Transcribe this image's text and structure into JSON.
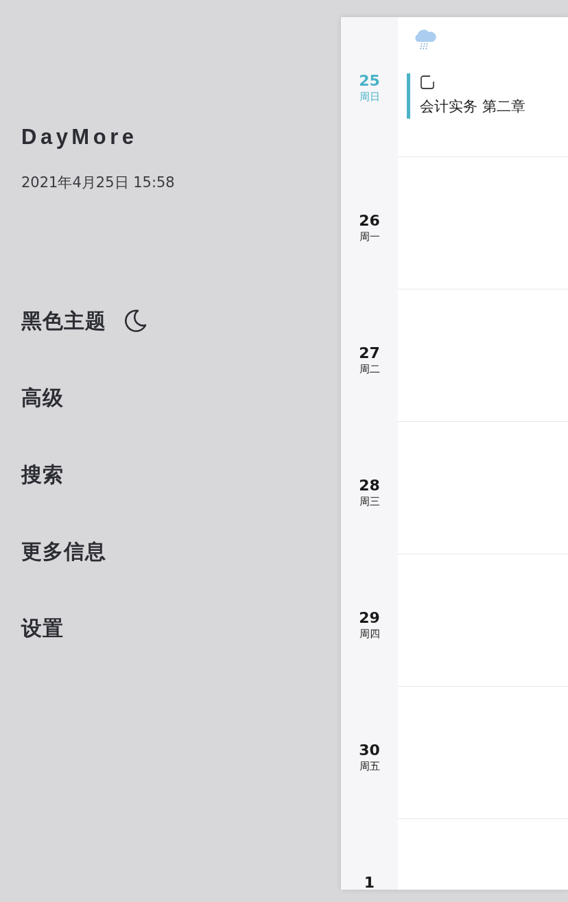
{
  "app": {
    "title": "DayMore",
    "datetime": "2021年4月25日 15:58"
  },
  "menu": [
    {
      "label": "黑色主题",
      "kind": "toggle"
    },
    {
      "label": "高级",
      "kind": "link"
    },
    {
      "label": "搜索",
      "kind": "link"
    },
    {
      "label": "更多信息",
      "kind": "link"
    },
    {
      "label": "设置",
      "kind": "link"
    }
  ],
  "days": [
    {
      "date": "25",
      "weekday": "周日",
      "selected": true,
      "kind": "rainy",
      "events": [
        {
          "title": "会计实务 第二章",
          "checked": false,
          "color": "#4bb3c8"
        }
      ]
    },
    {
      "date": "26",
      "weekday": "周一",
      "selected": false
    },
    {
      "date": "27",
      "weekday": "周二",
      "selected": false
    },
    {
      "date": "28",
      "weekday": "周三",
      "selected": false
    },
    {
      "date": "29",
      "weekday": "周四",
      "selected": false
    },
    {
      "date": "30",
      "weekday": "周五",
      "selected": false
    },
    {
      "date": "1",
      "selected": false
    }
  ]
}
